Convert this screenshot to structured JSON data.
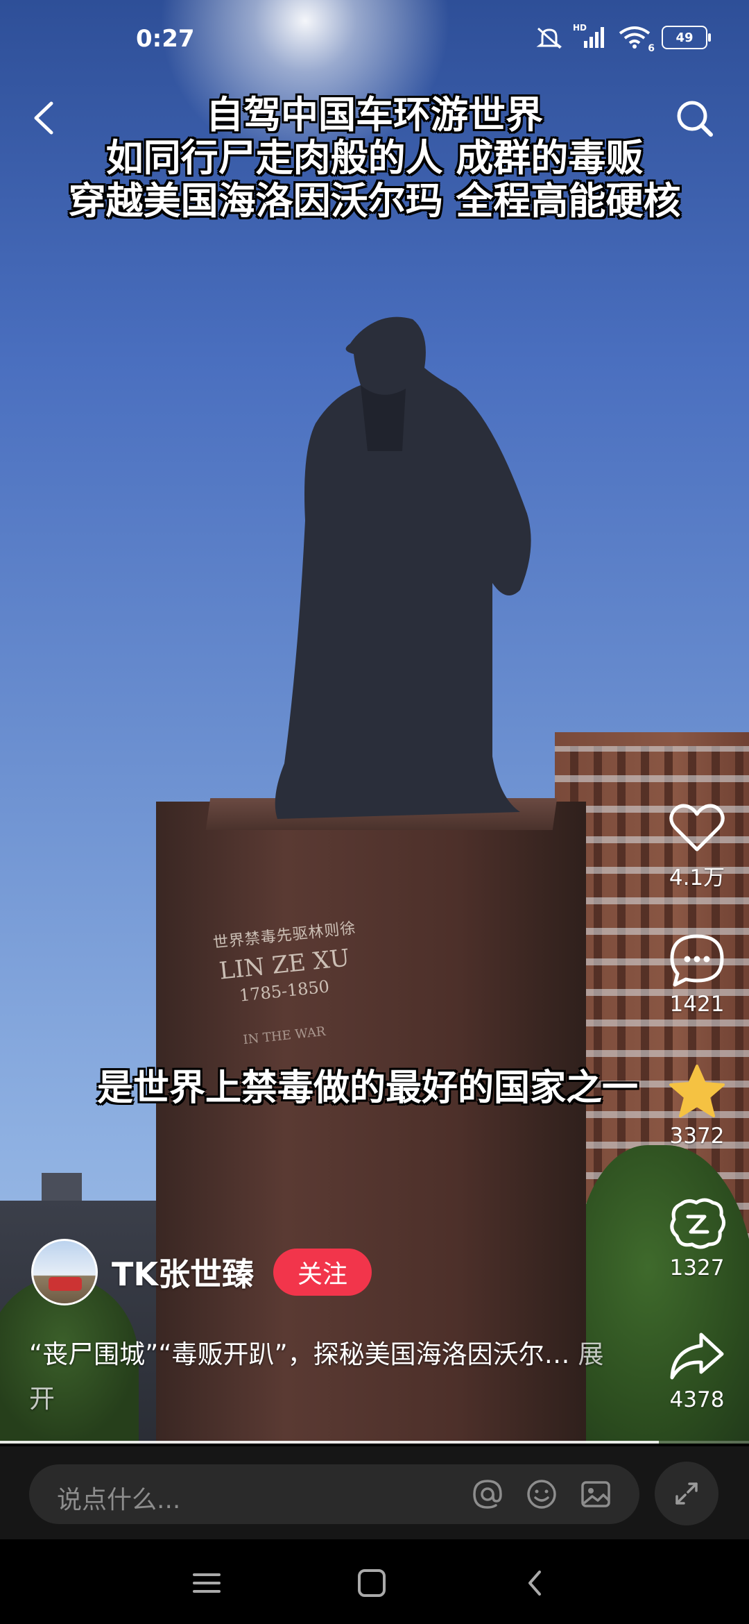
{
  "status_bar": {
    "time": "0:27",
    "hd_label": "HD",
    "wifi_label": "6",
    "battery": "49"
  },
  "video": {
    "title_lines": [
      "自驾中国车环游世界",
      "如同行尸走肉般的人 成群的毒贩",
      "穿越美国海洛因沃尔玛 全程高能硬核"
    ],
    "caption": "是世界上禁毒做的最好的国家之一",
    "inscription": {
      "chinese": "世界禁毒先驱林则徐",
      "name": "LIN ZE XU",
      "years": "1785-1850",
      "war": "IN THE WAR"
    },
    "progress": 0.88
  },
  "actions": {
    "like": {
      "icon": "heart-icon",
      "count": "4.1万"
    },
    "comment": {
      "icon": "comment-icon",
      "count": "1421"
    },
    "favorite": {
      "icon": "star-icon",
      "count": "3372",
      "color": "#f5c242"
    },
    "remix": {
      "icon": "remix-icon",
      "count": "1327"
    },
    "share": {
      "icon": "share-icon",
      "count": "4378"
    }
  },
  "author": {
    "name": "TK张世臻",
    "follow_label": "关注",
    "follow_color": "#f2354b"
  },
  "description": {
    "text": "“丧尸围城”“毒贩开趴”，探秘美国海洛因沃尔…",
    "more_label": "展开"
  },
  "comment_bar": {
    "placeholder": "说点什么..."
  }
}
